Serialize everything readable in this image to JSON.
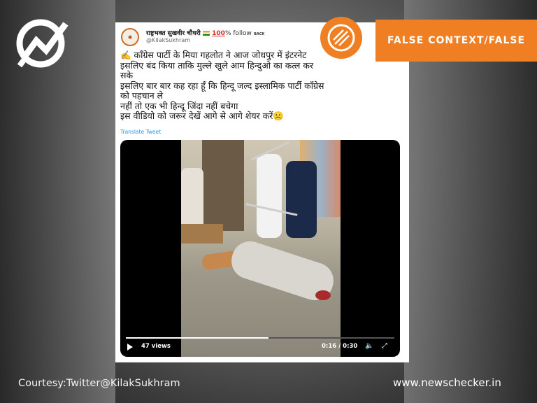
{
  "badge": {
    "verdict": "FALSE CONTEXT/FALSE",
    "accent": "#ef7f22"
  },
  "tweet": {
    "user_name": "राष्ट्रभक्त सुखवीर चौधरी",
    "hundred": "100",
    "follow": "% follow",
    "back": "BACK",
    "handle": "@KilakSukhram",
    "lines": [
      "✍️ काँग्रेस पार्टी के मिया गहलोत ने आज जोधपुर में इंटरनेट",
      "इसलिए बंद किया ताकि मुल्ले खुले आम हिन्दुओ का कत्ल कर",
      "सके",
      "इसलिए बार बार कह रहा हूँ कि हिन्दू जल्द इस्लामिक पार्टी काँग्रेस",
      "को पहचान ले",
      "नहीं तो एक भी हिन्दू जिंदा नहीं बचेगा",
      "इस वीडियो को जरूर देखें आगे से आगे शेयर करें☹️"
    ],
    "translate_label": "Translate Tweet",
    "video": {
      "views": "47 views",
      "time": "0:16 / 0:30",
      "progress": 0.53
    }
  },
  "footer": {
    "courtesy": "Courtesy:Twitter@KilakSukhram",
    "site": "www.newschecker.in"
  }
}
